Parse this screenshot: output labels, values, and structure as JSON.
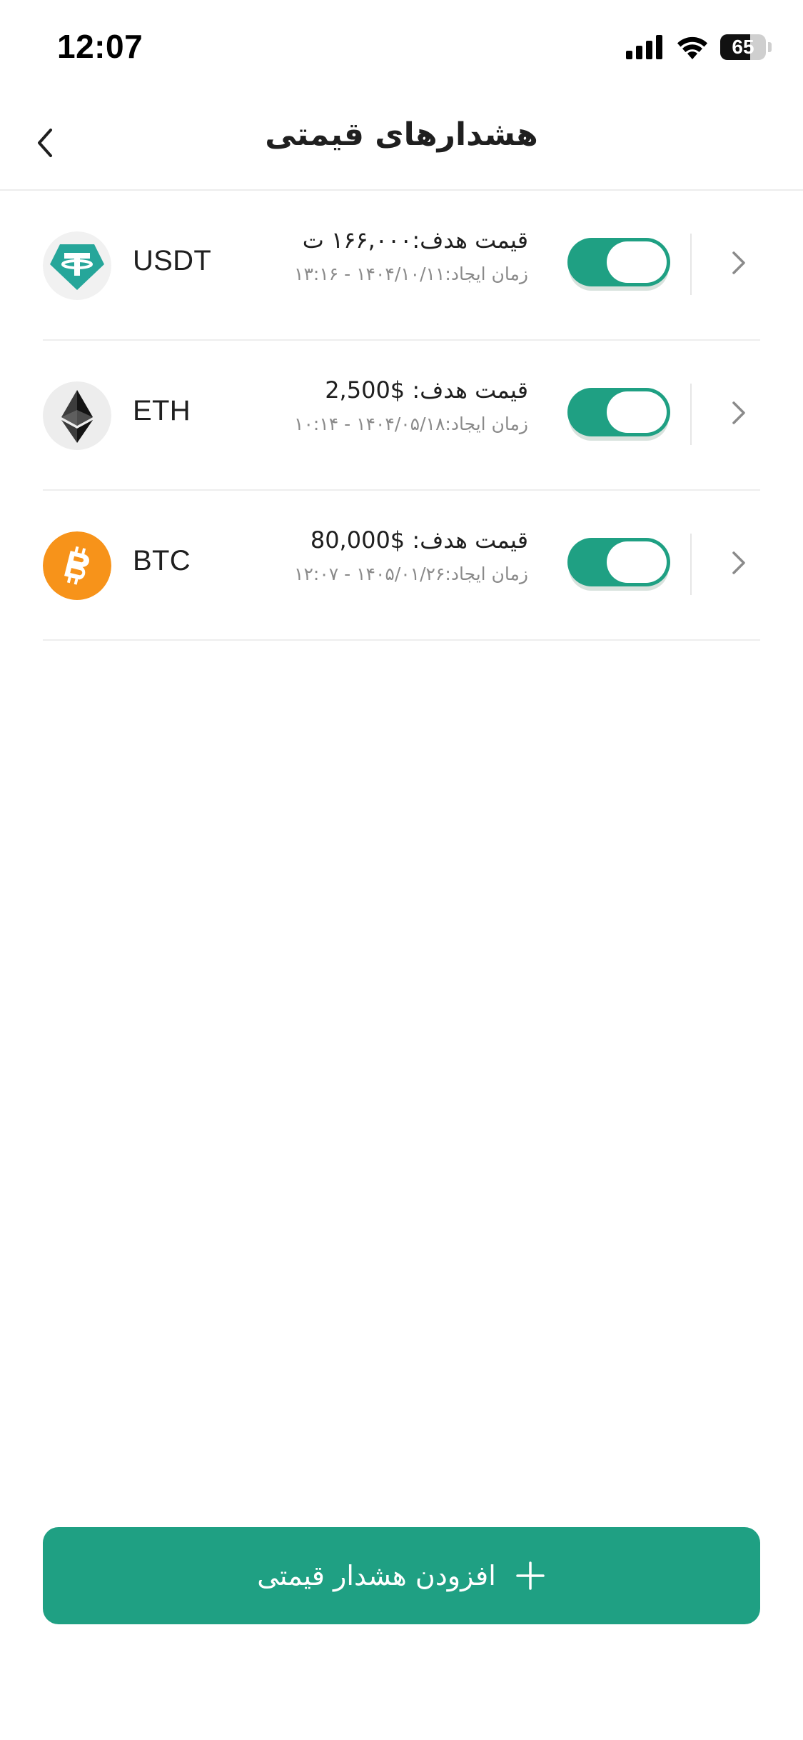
{
  "status_bar": {
    "time": "12:07",
    "battery_level": "65",
    "icons": [
      "signal-icon",
      "wifi-icon",
      "battery-icon"
    ]
  },
  "header": {
    "title": "هشدارهای قیمتی",
    "back_icon": "chevron-left-icon"
  },
  "alerts": [
    {
      "symbol": "USDT",
      "logo_icon": "tether-icon",
      "target": "قیمت هدف:۱۶۶,۰۰۰ ت",
      "created": "زمان ایجاد:۱۴۰۴/۱۰/۱۱ - ۱۳:۱۶",
      "enabled": true
    },
    {
      "symbol": "ETH",
      "logo_icon": "ethereum-icon",
      "target": "قیمت هدف: $2,500",
      "created": "زمان ایجاد:۱۴۰۴/۰۵/۱۸ - ۱۰:۱۴",
      "enabled": true
    },
    {
      "symbol": "BTC",
      "logo_icon": "bitcoin-icon",
      "target": "قیمت هدف: $80,000",
      "created": "زمان ایجاد:۱۴۰۵/۰۱/۲۶ - ۱۲:۰۷",
      "enabled": true
    }
  ],
  "add_button": {
    "label": "افزودن هشدار قیمتی",
    "icon": "plus-icon"
  },
  "colors": {
    "accent": "#1fa083",
    "tether": "#26a69a",
    "bitcoin": "#f7931a",
    "text_primary": "#1f1f1f",
    "text_secondary": "#8a8a8a"
  }
}
